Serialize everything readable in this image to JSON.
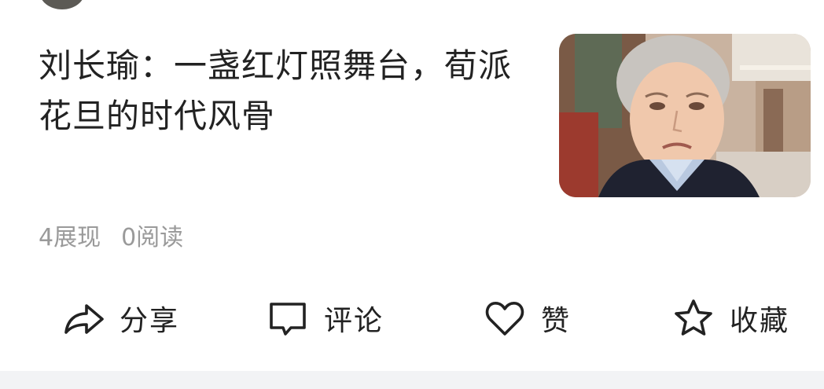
{
  "article": {
    "title": "刘长瑜：一盏红灯照舞台，荀派花旦的时代风骨",
    "thumbnail_icon": "portrait-photo"
  },
  "stats": {
    "impressions": "4展现",
    "reads": "0阅读"
  },
  "actions": [
    {
      "label": "分享",
      "icon": "share-icon"
    },
    {
      "label": "评论",
      "icon": "comment-icon"
    },
    {
      "label": "赞",
      "icon": "like-icon"
    },
    {
      "label": "收藏",
      "icon": "favorite-icon"
    }
  ]
}
